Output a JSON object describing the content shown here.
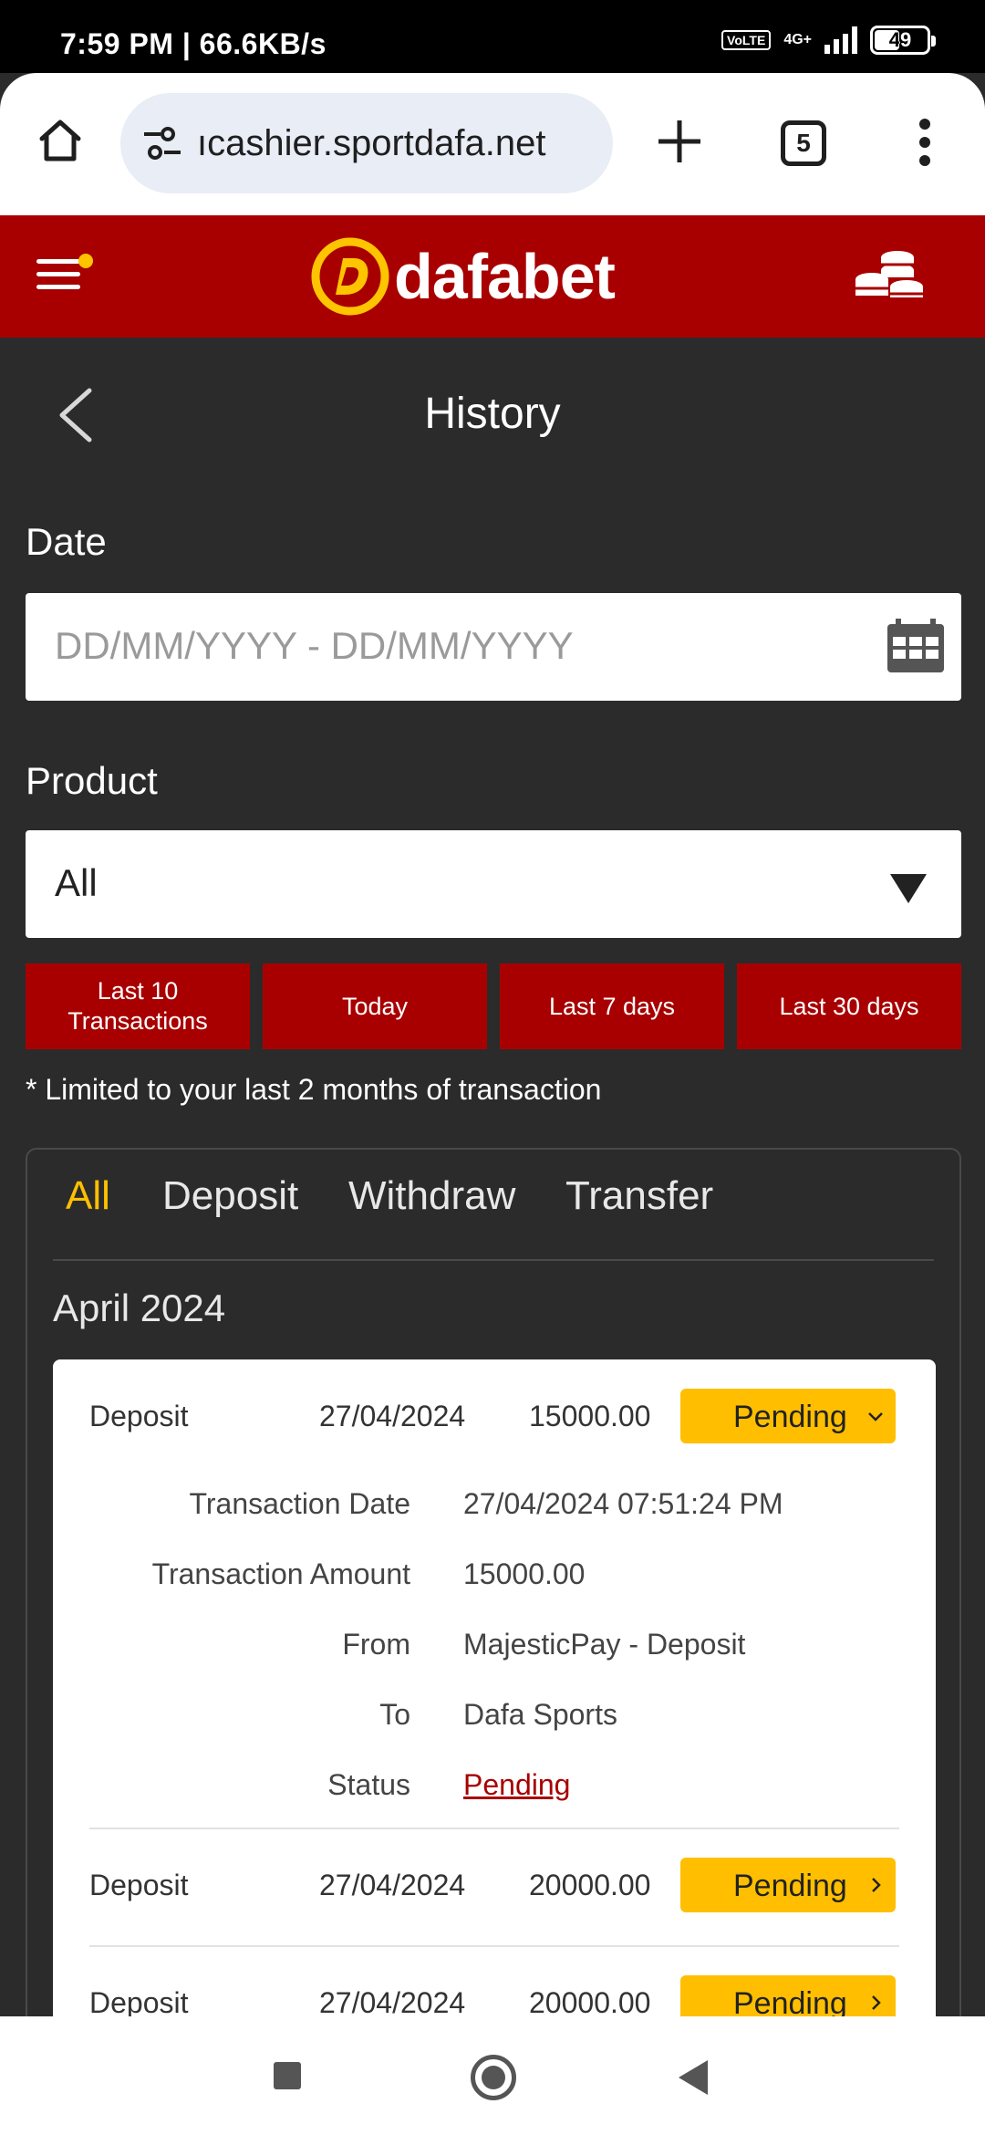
{
  "status_bar": {
    "time": "7:59 PM | 66.6KB/s",
    "network": "4G+",
    "volte": "VoLTE",
    "battery": "49",
    "battery_level": 0.49
  },
  "browser": {
    "url": "ıcashier.sportdafa.net",
    "tab_count": "5",
    "icons": [
      "home-icon",
      "site-settings-icon",
      "new-tab-icon",
      "tabs-icon",
      "more-menu-icon"
    ]
  },
  "header": {
    "brand": "dafabet",
    "brand_color": "#a80000",
    "accent_color": "#ffbf00",
    "icons": [
      "menu-icon",
      "dafabet-logo-icon",
      "coins-icon"
    ]
  },
  "page": {
    "title": "History",
    "date_label": "Date",
    "date_placeholder": "DD/MM/YYYY - DD/MM/YYYY",
    "product_label": "Product",
    "product_value": "All",
    "range_buttons": [
      "Last 10\nTransactions",
      "Today",
      "Last 7 days",
      "Last 30 days"
    ],
    "note": "* Limited to your last 2 months of transaction"
  },
  "tabs": [
    "All",
    "Deposit",
    "Withdraw",
    "Transfer"
  ],
  "active_tab": "All",
  "month": "April 2024",
  "transactions": [
    {
      "type": "Deposit",
      "date": "27/04/2024",
      "amount": "15000.00",
      "status": "Pending",
      "expanded": true
    },
    {
      "type": "Deposit",
      "date": "27/04/2024",
      "amount": "20000.00",
      "status": "Pending",
      "expanded": false
    },
    {
      "type": "Deposit",
      "date": "27/04/2024",
      "amount": "20000.00",
      "status": "Pending",
      "expanded": false
    }
  ],
  "details": {
    "labels": {
      "date": "Transaction Date",
      "amount": "Transaction Amount",
      "from": "From",
      "to": "To",
      "status": "Status"
    },
    "values": {
      "date": "27/04/2024 07:51:24 PM",
      "amount": "15000.00",
      "from": "MajesticPay - Deposit",
      "to": "Dafa Sports",
      "status": "Pending"
    }
  }
}
